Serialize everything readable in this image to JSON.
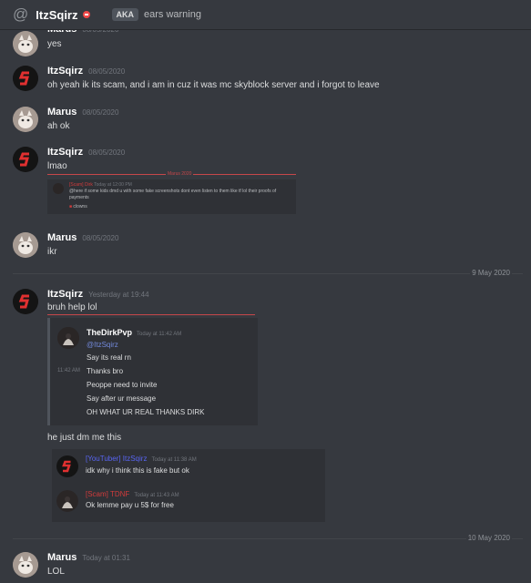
{
  "header": {
    "name": "ItzSqirz",
    "aka": "AKA",
    "aka_text": "ears warning"
  },
  "messages": [
    {
      "author": "Marus",
      "time": "08/05/2020",
      "text": "yes"
    },
    {
      "author": "ItzSqirz",
      "time": "08/05/2020",
      "text": "oh yeah ik its scam, and i am in cuz it was mc skyblock server and i forgot to leave"
    },
    {
      "author": "Marus",
      "time": "08/05/2020",
      "text": "ah ok"
    },
    {
      "author": "ItzSqirz",
      "time": "08/05/2020",
      "text": "lmao"
    },
    {
      "author": "Marus",
      "time": "08/05/2020",
      "text": "ikr"
    },
    {
      "author": "ItzSqirz",
      "time": "Yesterday at 19:44",
      "text": "bruh help lol"
    },
    {
      "text": "he just dm me this"
    },
    {
      "author": "Marus",
      "time": "Today at 01:31",
      "text": "LOL"
    }
  ],
  "mini_embed": {
    "label": "Marus 2020",
    "name": "[Scam] Dirk",
    "time": "Today at 12:00 PM",
    "text": "@here if some kids dmd u with some fake screenshots dont even listen to them like tf lol their proofs of payments",
    "reaction": "clowns"
  },
  "dividers": [
    "9 May 2020",
    "10 May 2020"
  ],
  "embed": {
    "name": "TheDirkPvp",
    "time": "Today at 11:42 AM",
    "side_time": "11:42 AM",
    "lines": [
      "@ItzSqirz",
      "Say its real rn",
      "Thanks bro",
      "Peoppe need to invite",
      "Say after ur message",
      "OH WHAT UR REAL THANKS DIRK"
    ]
  },
  "quotes": [
    {
      "name": "[YouTuber] ItzSqirz",
      "time": "Today at 11:38 AM",
      "text": "idk why i think this is fake but ok"
    },
    {
      "name": "[Scam] TDNF",
      "time": "Today at 11:43 AM",
      "text": "Ok lemme pay u 5$ for free"
    }
  ],
  "colors": {
    "bg": "#36393f",
    "mention": "#7289da",
    "youtuber": "#5865f2",
    "scam": "#d13b3b"
  }
}
